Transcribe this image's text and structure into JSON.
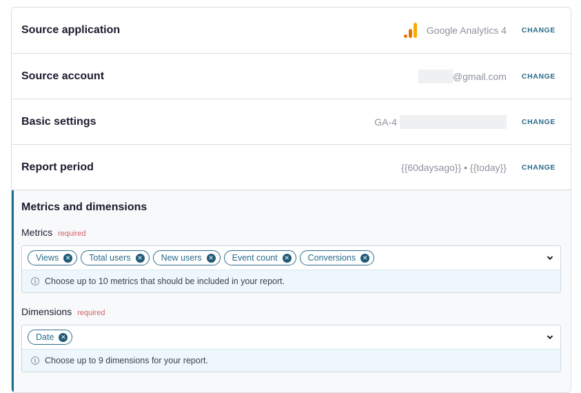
{
  "rows": [
    {
      "title": "Source application",
      "value": "Google Analytics 4",
      "action": "CHANGE",
      "icon": "google-analytics-icon"
    },
    {
      "title": "Source account",
      "value": "@gmail.com",
      "action": "CHANGE"
    },
    {
      "title": "Basic settings",
      "value": "GA-4",
      "action": "CHANGE"
    },
    {
      "title": "Report period",
      "value": "{{60daysago}} • {{today}}",
      "action": "CHANGE"
    }
  ],
  "section": {
    "title": "Metrics and dimensions",
    "metrics": {
      "label": "Metrics",
      "required": "required",
      "chips": [
        "Views",
        "Total users",
        "New users",
        "Event count",
        "Conversions"
      ],
      "hint": "Choose up to 10 metrics that should be included in your report."
    },
    "dimensions": {
      "label": "Dimensions",
      "required": "required",
      "chips": [
        "Date"
      ],
      "hint": "Choose up to 9 dimensions for your report."
    }
  },
  "colors": {
    "accent": "#2a6b8a",
    "required": "#d0636a",
    "ga_orange": "#e37400",
    "ga_yellow": "#f9ab00"
  }
}
